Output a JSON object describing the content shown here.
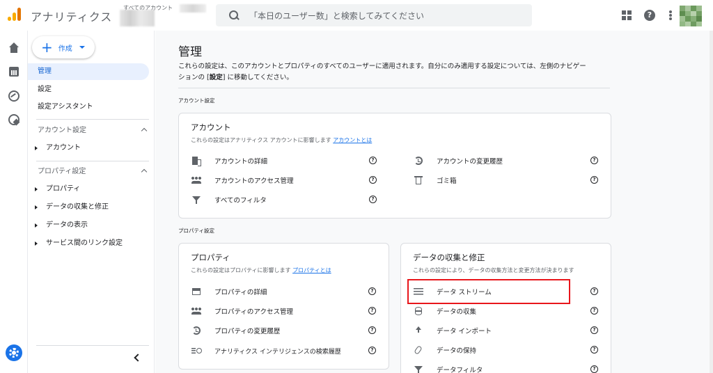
{
  "header": {
    "app_title": "アナリティクス",
    "account_label": "すべてのアカウント",
    "search_placeholder": "「本日のユーザー数」と検索してみてください"
  },
  "nav": {
    "create_label": "作成",
    "items": [
      {
        "label": "管理",
        "active": true
      },
      {
        "label": "設定",
        "active": false
      },
      {
        "label": "設定アシスタント",
        "active": false
      }
    ],
    "account_section": {
      "title": "アカウント設定",
      "items": [
        "アカウント"
      ]
    },
    "property_section": {
      "title": "プロパティ設定",
      "items": [
        "プロパティ",
        "データの収集と修正",
        "データの表示",
        "サービス間のリンク設定"
      ]
    }
  },
  "main": {
    "title": "管理",
    "description_line1": "これらの設定は、このアカウントとプロパティのすべてのユーザーに適用されます。自分にのみ適用する設定については、左側のナビゲー",
    "description_line2_pre": "ションの [",
    "description_line2_bold": "設定",
    "description_line2_post": "] に移動してください。",
    "account_settings_label": "アカウント設定",
    "property_settings_label": "プロパティ設定",
    "account_card": {
      "title": "アカウント",
      "subtitle": "これらの設定はアナリティクス アカウントに影響します",
      "link": "アカウントとは",
      "left_rows": [
        {
          "label": "アカウントの詳細",
          "icon": "building-icon"
        },
        {
          "label": "アカウントのアクセス管理",
          "icon": "people-icon"
        },
        {
          "label": "すべてのフィルタ",
          "icon": "filter-icon"
        }
      ],
      "right_rows": [
        {
          "label": "アカウントの変更履歴",
          "icon": "history-icon"
        },
        {
          "label": "ゴミ箱",
          "icon": "trash-icon"
        }
      ]
    },
    "property_card": {
      "title": "プロパティ",
      "subtitle": "これらの設定はプロパティに影響します",
      "link": "プロパティとは",
      "rows": [
        {
          "label": "プロパティの詳細",
          "icon": "window-icon"
        },
        {
          "label": "プロパティのアクセス管理",
          "icon": "people-icon"
        },
        {
          "label": "プロパティの変更履歴",
          "icon": "history-icon"
        },
        {
          "label": "アナリティクス インテリジェンスの検索履歴",
          "icon": "search-list-icon"
        }
      ]
    },
    "data_card": {
      "title": "データの収集と修正",
      "subtitle": "これらの設定により、データの収集方法と変更方法が決まります",
      "rows": [
        {
          "label": "データ ストリーム",
          "icon": "stream-icon"
        },
        {
          "label": "データの収集",
          "icon": "database-icon"
        },
        {
          "label": "データ インポート",
          "icon": "upload-icon"
        },
        {
          "label": "データの保持",
          "icon": "clip-icon"
        },
        {
          "label": "データフィルタ",
          "icon": "filter-icon"
        }
      ]
    },
    "help_glyph": "?"
  },
  "colors": {
    "accent": "#1a73e8",
    "highlight": "#e8161b",
    "orange": "#f9ab00"
  }
}
